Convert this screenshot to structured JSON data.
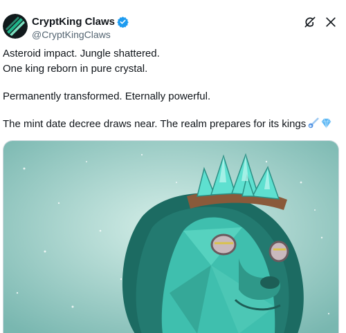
{
  "author": {
    "display_name": "CryptKing Claws",
    "handle": "@CryptKingClaws",
    "verified": true,
    "verified_color": "#1d9bf0"
  },
  "actions": {
    "grok_icon": "grok-icon",
    "close_icon": "close-icon"
  },
  "post": {
    "lines": [
      "Asteroid impact. Jungle shattered.",
      "One king reborn in pure crystal.",
      "Permanently transformed. Eternally powerful.",
      "The mint date decree draws near. The realm prepares for its kings"
    ],
    "emojis": [
      "comet",
      "gem-stone"
    ]
  },
  "media": {
    "description_icon": "crystal-lion-image",
    "background_color": "#a8d8d2",
    "lion_color": "#3fbfae"
  }
}
